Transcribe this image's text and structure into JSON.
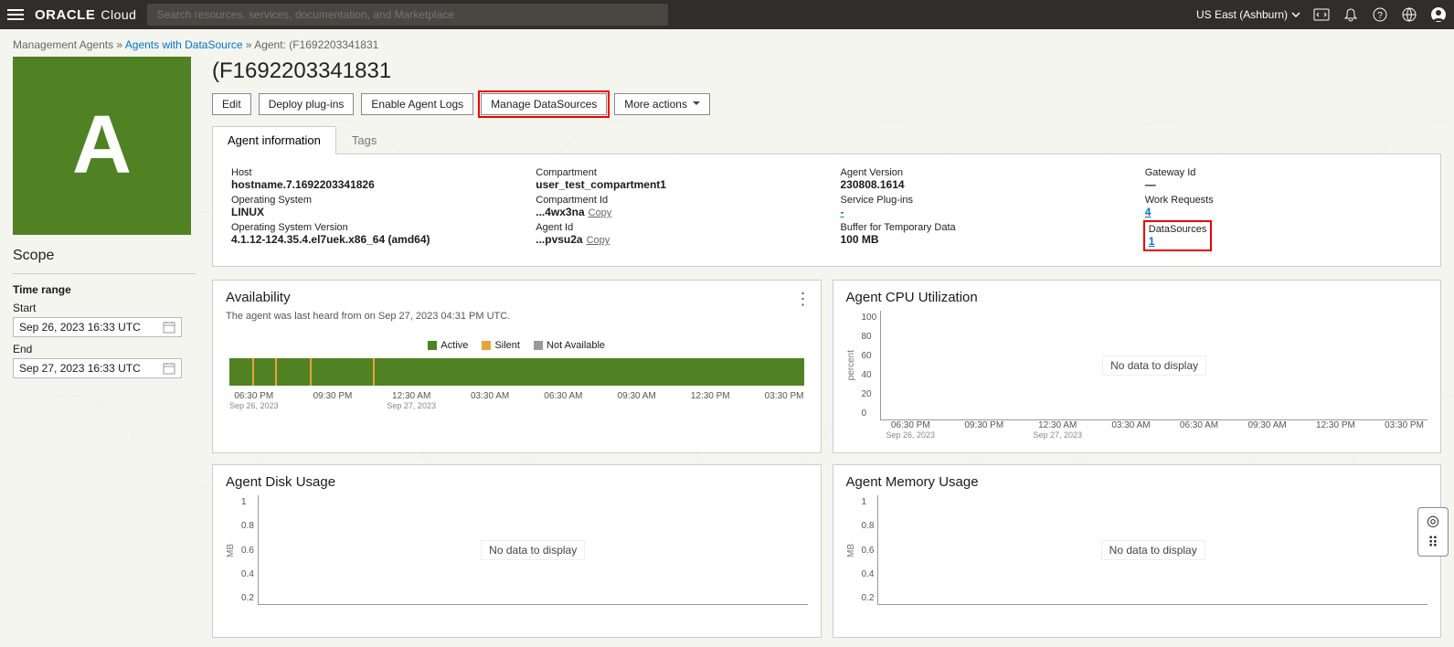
{
  "header": {
    "search_placeholder": "Search resources, services, documentation, and Marketplace",
    "region": "US East (Ashburn)",
    "brand_bold": "ORACLE",
    "brand_light": "Cloud"
  },
  "breadcrumb": {
    "root": "Management Agents",
    "mid": "Agents with DataSource",
    "leaf": "Agent: (F1692203341831"
  },
  "title": "(F1692203341831",
  "buttons": {
    "edit": "Edit",
    "deploy": "Deploy plug-ins",
    "enable_logs": "Enable Agent Logs",
    "manage_ds": "Manage DataSources",
    "more": "More actions"
  },
  "tabs": {
    "info": "Agent information",
    "tags": "Tags"
  },
  "info": {
    "host_label": "Host",
    "host_value": "hostname.7.1692203341826",
    "os_label": "Operating System",
    "os_value": "LINUX",
    "osver_label": "Operating System Version",
    "osver_value": "4.1.12-124.35.4.el7uek.x86_64 (amd64)",
    "comp_label": "Compartment",
    "comp_value": "user_test_compartment1",
    "compid_label": "Compartment Id",
    "compid_value": "...4wx3na",
    "agentid_label": "Agent Id",
    "agentid_value": "...pvsu2a",
    "copy": "Copy",
    "aver_label": "Agent Version",
    "aver_value": "230808.1614",
    "plugins_label": "Service Plug-ins",
    "plugins_value": "-",
    "buffer_label": "Buffer for Temporary Data",
    "buffer_value": "100 MB",
    "gw_label": "Gateway Id",
    "gw_value": "—",
    "wr_label": "Work Requests",
    "wr_value": "4",
    "ds_label": "DataSources",
    "ds_value": "1"
  },
  "scope": {
    "title": "Scope",
    "timerange": "Time range",
    "start_label": "Start",
    "start_value": "Sep 26, 2023 16:33 UTC",
    "end_label": "End",
    "end_value": "Sep 27, 2023 16:33 UTC"
  },
  "avatar_letter": "A",
  "panels": {
    "avail_title": "Availability",
    "avail_sub": "The agent was last heard from on Sep 27, 2023 04:31 PM UTC.",
    "legend_active": "Active",
    "legend_silent": "Silent",
    "legend_na": "Not Available",
    "cpu_title": "Agent CPU Utilization",
    "disk_title": "Agent Disk Usage",
    "mem_title": "Agent Memory Usage",
    "nodata": "No data to display",
    "ylabel_percent": "percent",
    "ylabel_mb": "MB"
  },
  "chart_data": [
    {
      "type": "bar",
      "id": "availability",
      "categories": [
        "06:30 PM\nSep 26, 2023",
        "09:30 PM",
        "12:30 AM\nSep 27, 2023",
        "03:30 AM",
        "06:30 AM",
        "09:30 AM",
        "12:30 PM",
        "03:30 PM"
      ],
      "series": [
        {
          "name": "Active",
          "values": [
            1,
            1,
            1,
            1,
            1,
            1,
            1,
            1
          ]
        }
      ],
      "silent_marks_pct": [
        4,
        8,
        14,
        25
      ]
    },
    {
      "type": "line",
      "id": "cpu",
      "title": "Agent CPU Utilization",
      "ylabel": "percent",
      "ylim": [
        0,
        100
      ],
      "yticks": [
        0,
        20,
        40,
        60,
        80,
        100
      ],
      "categories": [
        "06:30 PM\nSep 26, 2023",
        "09:30 PM",
        "12:30 AM\nSep 27, 2023",
        "03:30 AM",
        "06:30 AM",
        "09:30 AM",
        "12:30 PM",
        "03:30 PM"
      ],
      "values": null,
      "nodata": true
    },
    {
      "type": "line",
      "id": "disk",
      "title": "Agent Disk Usage",
      "ylabel": "MB",
      "ylim": [
        0,
        1.0
      ],
      "yticks": [
        0.2,
        0.4,
        0.6,
        0.8,
        1.0
      ],
      "values": null,
      "nodata": true
    },
    {
      "type": "line",
      "id": "memory",
      "title": "Agent Memory Usage",
      "ylabel": "MB",
      "ylim": [
        0,
        1.0
      ],
      "yticks": [
        0.2,
        0.4,
        0.6,
        0.8,
        1.0
      ],
      "values": null,
      "nodata": true
    }
  ],
  "xaxis_full": [
    {
      "t": "06:30 PM",
      "s": "Sep 26, 2023"
    },
    {
      "t": "09:30 PM",
      "s": ""
    },
    {
      "t": "12:30 AM",
      "s": "Sep 27, 2023"
    },
    {
      "t": "03:30 AM",
      "s": ""
    },
    {
      "t": "06:30 AM",
      "s": ""
    },
    {
      "t": "09:30 AM",
      "s": ""
    },
    {
      "t": "12:30 PM",
      "s": ""
    },
    {
      "t": "03:30 PM",
      "s": ""
    }
  ]
}
